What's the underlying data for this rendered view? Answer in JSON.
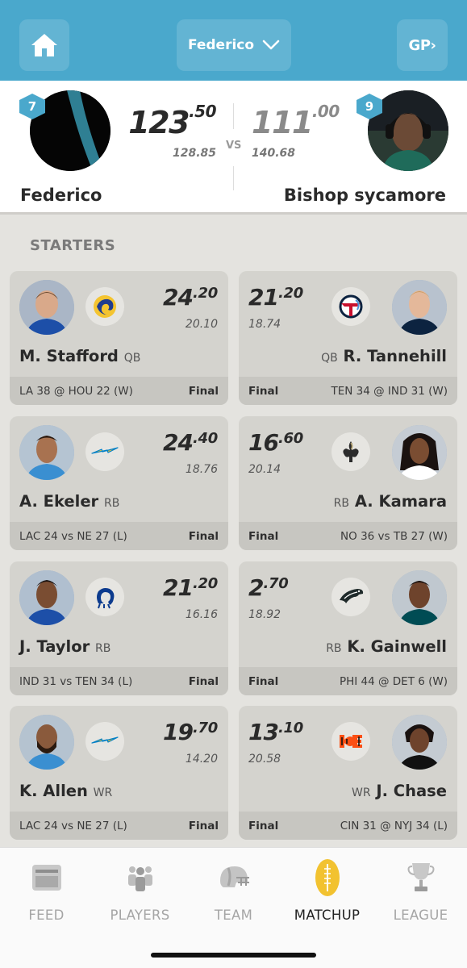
{
  "topbar": {
    "selected_team": "Federico",
    "gp_label": "GP›",
    "accent_color": "#4aa8cc",
    "icons": [
      "home-icon",
      "chevron-down-icon"
    ]
  },
  "matchup": {
    "left": {
      "rank": "7",
      "score_int": "123",
      "score_dec": ".50",
      "projected": "128.85",
      "name": "Federico"
    },
    "vs": "VS",
    "right": {
      "rank": "9",
      "score_int": "111",
      "score_dec": ".00",
      "projected": "140.68",
      "name": "Bishop sycamore"
    }
  },
  "section_label": "STARTERS",
  "starters": [
    {
      "left": {
        "name": "M. Stafford",
        "pos": "QB",
        "team_logo": "rams-logo",
        "score_int": "24",
        "score_dec": ".20",
        "projected": "20.10",
        "game": "LA 38 @ HOU 22 (W)",
        "status": "Final"
      },
      "right": {
        "name": "R. Tannehill",
        "pos": "QB",
        "team_logo": "titans-logo",
        "score_int": "21",
        "score_dec": ".20",
        "projected": "18.74",
        "game": "TEN 34 @ IND 31 (W)",
        "status": "Final"
      }
    },
    {
      "left": {
        "name": "A. Ekeler",
        "pos": "RB",
        "team_logo": "chargers-logo",
        "score_int": "24",
        "score_dec": ".40",
        "projected": "18.76",
        "game": "LAC 24 vs NE 27 (L)",
        "status": "Final"
      },
      "right": {
        "name": "A. Kamara",
        "pos": "RB",
        "team_logo": "saints-logo",
        "score_int": "16",
        "score_dec": ".60",
        "projected": "20.14",
        "game": "NO 36 vs TB 27 (W)",
        "status": "Final"
      }
    },
    {
      "left": {
        "name": "J. Taylor",
        "pos": "RB",
        "team_logo": "colts-logo",
        "score_int": "21",
        "score_dec": ".20",
        "projected": "16.16",
        "game": "IND 31 vs TEN 34 (L)",
        "status": "Final"
      },
      "right": {
        "name": "K. Gainwell",
        "pos": "RB",
        "team_logo": "eagles-logo",
        "score_int": "2",
        "score_dec": ".70",
        "projected": "18.92",
        "game": "PHI 44 @ DET 6 (W)",
        "status": "Final"
      }
    },
    {
      "left": {
        "name": "K. Allen",
        "pos": "WR",
        "team_logo": "chargers-logo",
        "score_int": "19",
        "score_dec": ".70",
        "projected": "14.20",
        "game": "LAC 24 vs NE 27 (L)",
        "status": "Final"
      },
      "right": {
        "name": "J. Chase",
        "pos": "WR",
        "team_logo": "bengals-logo",
        "score_int": "13",
        "score_dec": ".10",
        "projected": "20.58",
        "game": "CIN 31 @ NYJ 34 (L)",
        "status": "Final"
      }
    }
  ],
  "bottom_nav": [
    {
      "label": "FEED",
      "icon": "feed-icon",
      "active": false
    },
    {
      "label": "PLAYERS",
      "icon": "players-icon",
      "active": false
    },
    {
      "label": "TEAM",
      "icon": "helmet-icon",
      "active": false
    },
    {
      "label": "MATCHUP",
      "icon": "football-icon",
      "active": true
    },
    {
      "label": "LEAGUE",
      "icon": "trophy-icon",
      "active": false
    }
  ]
}
